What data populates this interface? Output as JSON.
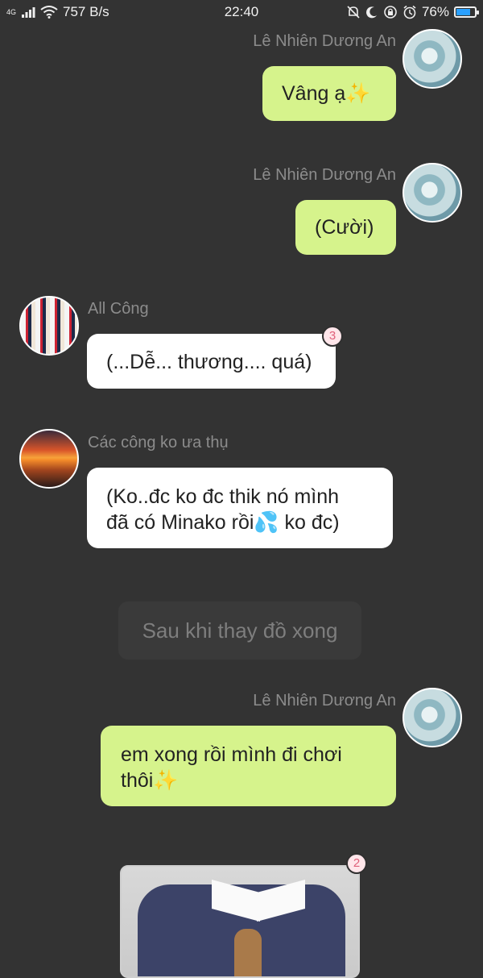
{
  "status_bar": {
    "network": "4G",
    "speed": "757 B/s",
    "time": "22:40",
    "battery_percent": "76%",
    "battery_level": 0.76
  },
  "messages": [
    {
      "sender": "Lê Nhiên Dương An",
      "text": "Vâng ạ✨",
      "side": "right"
    },
    {
      "sender": "Lê Nhiên Dương An",
      "text": "(Cười)",
      "side": "right"
    },
    {
      "sender": "All Công",
      "text": "(...Dễ... thương.... quá)",
      "side": "left",
      "badge": "3"
    },
    {
      "sender": "Các công ko ưa thụ",
      "text_line1": "(Ko..đc ko đc thik nó mình",
      "text_line2": "đã có Minako rồi💦 ko đc)",
      "side": "left"
    },
    {
      "sender": "Lê Nhiên Dương An",
      "text_line1": "em xong rồi mình đi chơi",
      "text_line2": "thôi✨",
      "side": "right"
    }
  ],
  "narration": "Sau khi thay đồ xong",
  "photo_message": {
    "badge": "2"
  },
  "colors": {
    "background": "#333333",
    "bubble_green": "#d6f38c",
    "bubble_white": "#ffffff",
    "badge_text": "#e0607a"
  }
}
